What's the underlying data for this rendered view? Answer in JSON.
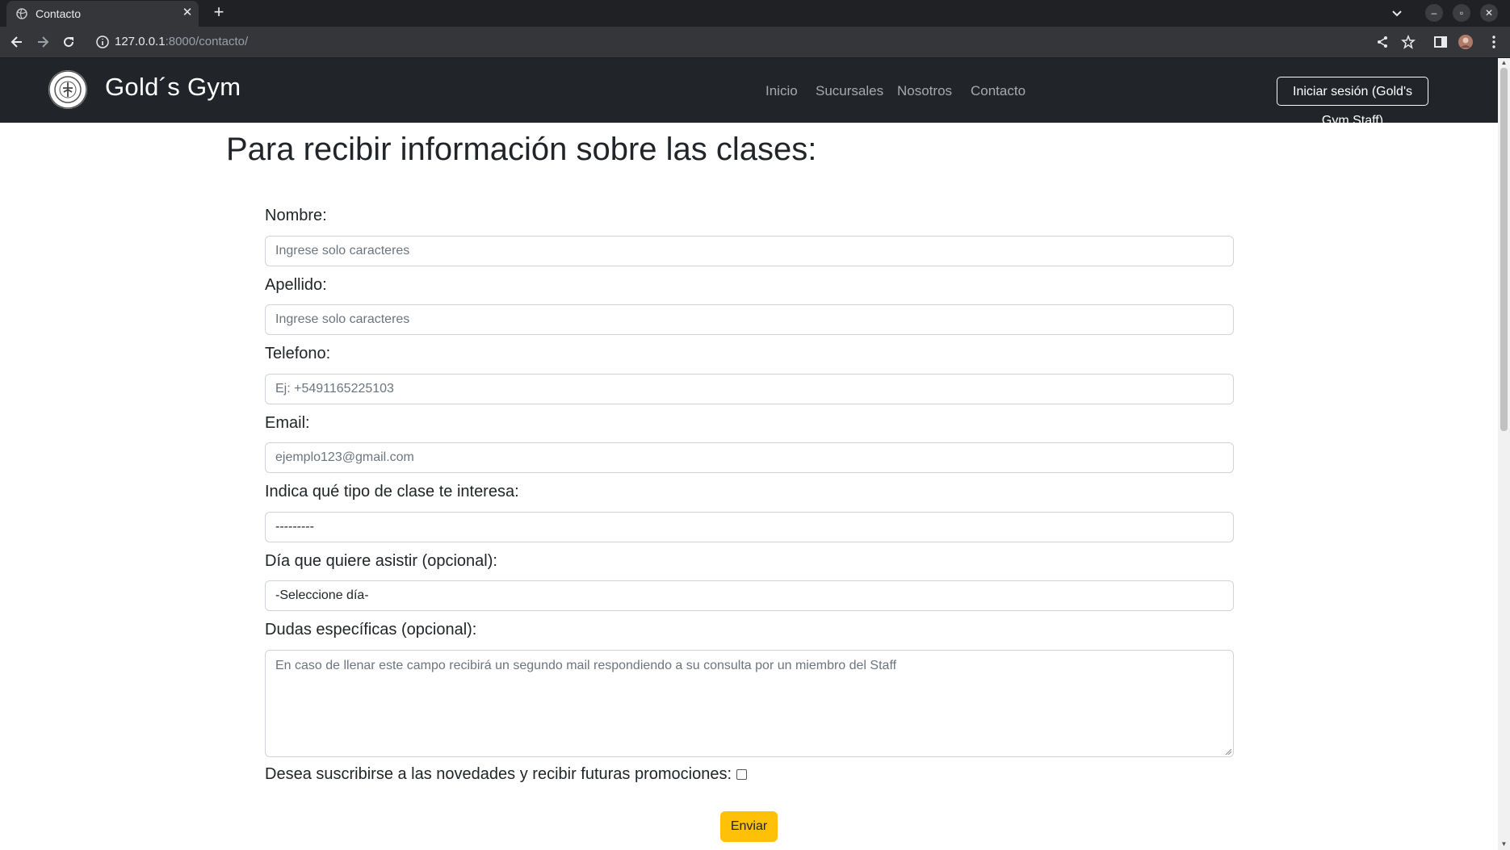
{
  "browser": {
    "tab_title": "Contacto",
    "url_host": "127.0.0.1",
    "url_rest": ":8000/contacto/"
  },
  "navbar": {
    "brand": "Gold´s Gym",
    "links": [
      "Inicio",
      "Sucursales",
      "Nosotros",
      "Contacto"
    ],
    "login_button": "Iniciar sesión (Gold's Gym Staff)"
  },
  "page": {
    "title": "Para recibir información sobre las clases:"
  },
  "form": {
    "nombre": {
      "label": "Nombre:",
      "placeholder": "Ingrese solo caracteres"
    },
    "apellido": {
      "label": "Apellido:",
      "placeholder": "Ingrese solo caracteres"
    },
    "telefono": {
      "label": "Telefono:",
      "placeholder": "Ej: +5491165225103"
    },
    "email": {
      "label": "Email:",
      "placeholder": "ejemplo123@gmail.com"
    },
    "tipo_clase": {
      "label": "Indica qué tipo de clase te interesa:",
      "value": "---------"
    },
    "dia": {
      "label": "Día que quiere asistir (opcional):",
      "value": "-Seleccione día-"
    },
    "dudas": {
      "label": "Dudas específicas (opcional):",
      "placeholder": "En caso de llenar este campo recibirá un segundo mail respondiendo a su consulta por un miembro del Staff"
    },
    "suscribirse_label": "Desea suscribirse a las novedades y recibir futuras promociones:",
    "suscribirse_checked": false,
    "submit_label": "Enviar"
  },
  "colors": {
    "navbar_bg": "#212529",
    "submit_bg": "#ffc107"
  }
}
